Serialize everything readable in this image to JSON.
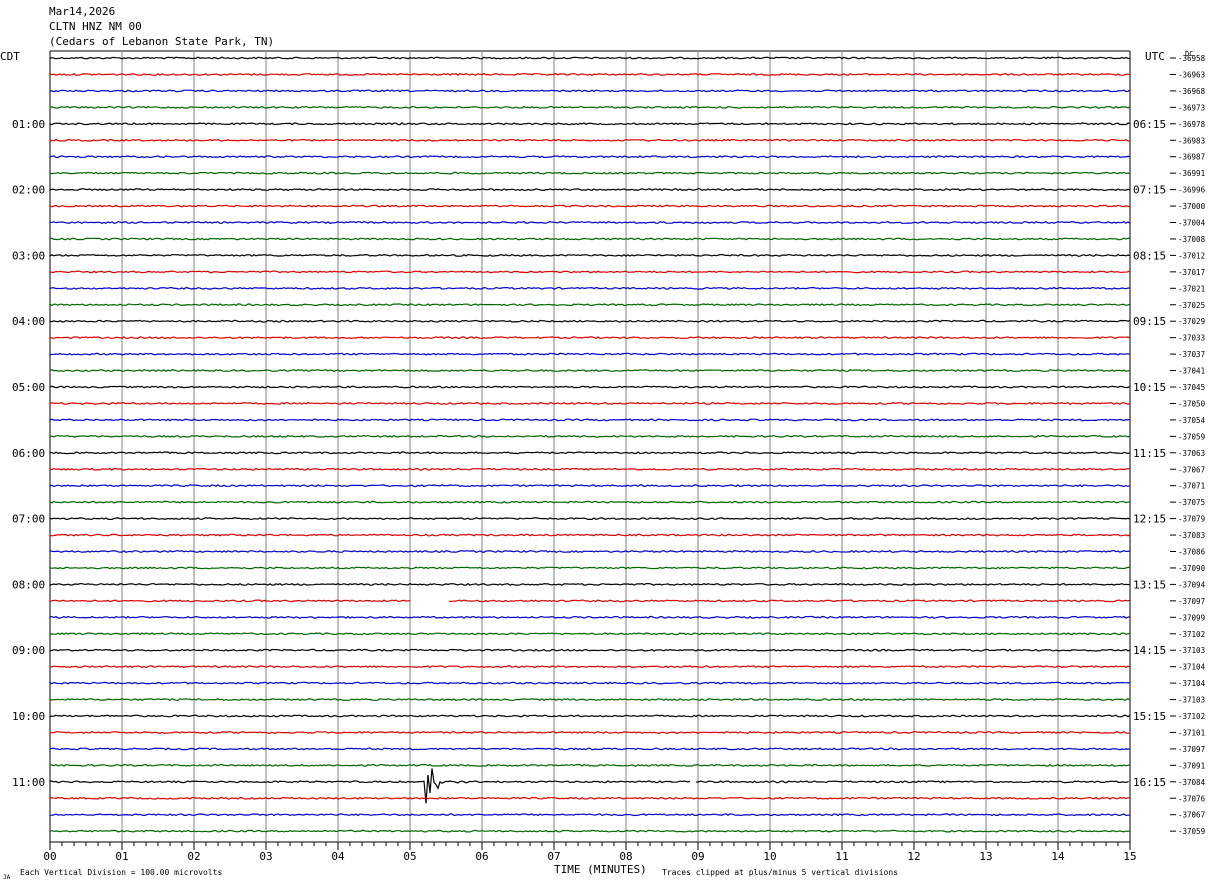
{
  "header": {
    "date": "Mar14,2026",
    "station": "CLTN HNZ NM 00",
    "location": "(Cedars of Lebanon State Park, TN)"
  },
  "chart_data": {
    "type": "line",
    "title": "CLTN HNZ NM 00",
    "left_axis_title": "CDT",
    "right_axis_title": "UTC",
    "dc_label": "DC",
    "xlabel": "TIME (MINUTES)",
    "xlim": [
      0,
      15
    ],
    "x_ticks": [
      "00",
      "01",
      "02",
      "03",
      "04",
      "05",
      "06",
      "07",
      "08",
      "09",
      "10",
      "11",
      "12",
      "13",
      "14",
      "15"
    ],
    "left_hour_labels": [
      "01:00",
      "02:00",
      "03:00",
      "04:00",
      "05:00",
      "06:00",
      "07:00",
      "08:00",
      "09:00",
      "10:00",
      "11:00"
    ],
    "right_hour_labels": [
      "06:15",
      "07:15",
      "08:15",
      "09:15",
      "10:15",
      "11:15",
      "12:15",
      "13:15",
      "14:15",
      "15:15",
      "16:15"
    ],
    "dc_offsets": [
      "-36958",
      "-36963",
      "-36968",
      "-36973",
      "-36978",
      "-36983",
      "-36987",
      "-36991",
      "-36996",
      "-37000",
      "-37004",
      "-37008",
      "-37012",
      "-37017",
      "-37021",
      "-37025",
      "-37029",
      "-37033",
      "-37037",
      "-37041",
      "-37045",
      "-37050",
      "-37054",
      "-37059",
      "-37063",
      "-37067",
      "-37071",
      "-37075",
      "-37079",
      "-37083",
      "-37086",
      "-37090",
      "-37094",
      "-37097",
      "-37099",
      "-37102",
      "-37103",
      "-37104",
      "-37104",
      "-37103",
      "-37102",
      "-37101",
      "-37097",
      "-37091",
      "-37084",
      "-37076",
      "-37067",
      "-37059"
    ],
    "trace_colors": [
      "#000000",
      "#dd0000",
      "#0000cc",
      "#006600"
    ],
    "trace_minutes_per_line": 15,
    "gaps": [
      {
        "trace": 33,
        "start_min": 5.0,
        "end_min": 5.55
      },
      {
        "trace": 44,
        "start_min": 8.9,
        "end_min": 8.98
      }
    ],
    "events": [
      {
        "trace": 44,
        "minute": 5.2,
        "amplitude_divisions": 2
      }
    ],
    "footer_left": "Each Vertical Division =  100.00 microvolts",
    "footer_right": "Traces clipped at plus/minus 5 vertical divisions"
  }
}
